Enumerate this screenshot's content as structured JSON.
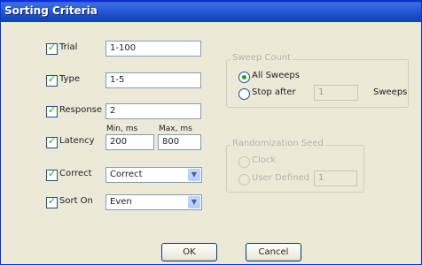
{
  "dialog": {
    "title": "Sorting Criteria"
  },
  "criteria": {
    "trial": {
      "label": "Trial",
      "value": "1-100",
      "checked": true
    },
    "type": {
      "label": "Type",
      "value": "1-5",
      "checked": true
    },
    "response": {
      "label": "Response",
      "value": "2",
      "checked": true
    },
    "latency": {
      "label": "Latency",
      "min_label": "Min, ms",
      "max_label": "Max, ms",
      "min_value": "200",
      "max_value": "800",
      "checked": true
    },
    "correct": {
      "label": "Correct",
      "selected": "Correct",
      "checked": true
    },
    "sort_on": {
      "label": "Sort On",
      "selected": "Even",
      "checked": true
    }
  },
  "sweep_count": {
    "title": "Sweep Count",
    "all_sweeps_label": "All Sweeps",
    "stop_after_label": "Stop after",
    "stop_after_value": "1",
    "sweeps_label": "Sweeps",
    "selected": "all"
  },
  "randomization_seed": {
    "title": "Randomization Seed",
    "clock_label": "Clock",
    "user_defined_label": "User Defined",
    "user_defined_value": "1",
    "enabled": false
  },
  "buttons": {
    "ok": "OK",
    "cancel": "Cancel"
  },
  "colors": {
    "title_bar": "#2b5dd8",
    "dialog_bg": "#ece9d8",
    "check_mark": "#21a121"
  }
}
